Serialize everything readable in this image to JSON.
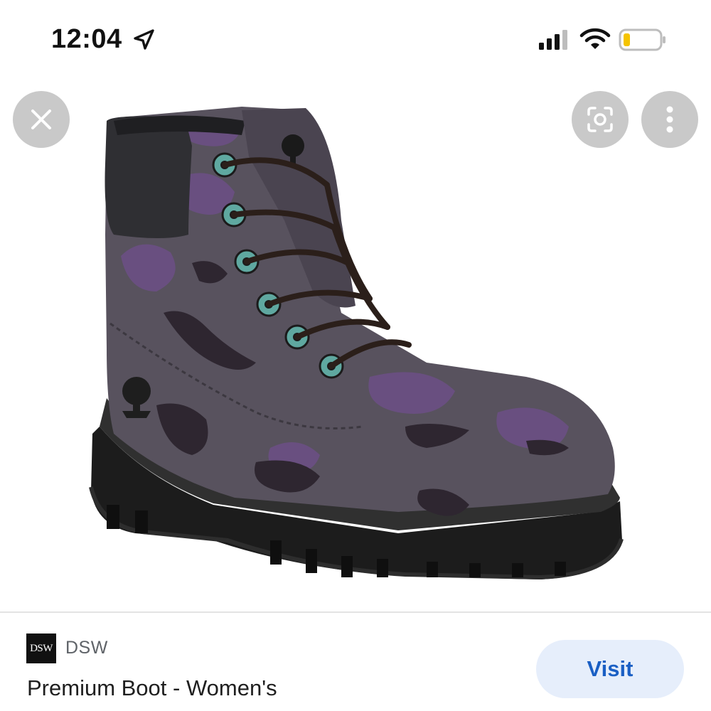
{
  "status_bar": {
    "time": "12:04",
    "icons": [
      "location-arrow-icon",
      "cellular-signal-icon",
      "wifi-icon",
      "battery-low-icon"
    ],
    "battery_color": "#f5c400"
  },
  "viewer": {
    "image_subject": "purple camouflage lace-up boot",
    "buttons": [
      "close-icon",
      "lens-icon",
      "more-vertical-icon"
    ]
  },
  "result": {
    "source_logo_text": "DSW",
    "source_name": "DSW",
    "title": "Premium Boot - Women's",
    "visit_label": "Visit"
  },
  "colors": {
    "button_circle": "#c9c9c9",
    "visit_bg": "#e6eefb",
    "visit_text": "#1a5fc4"
  }
}
